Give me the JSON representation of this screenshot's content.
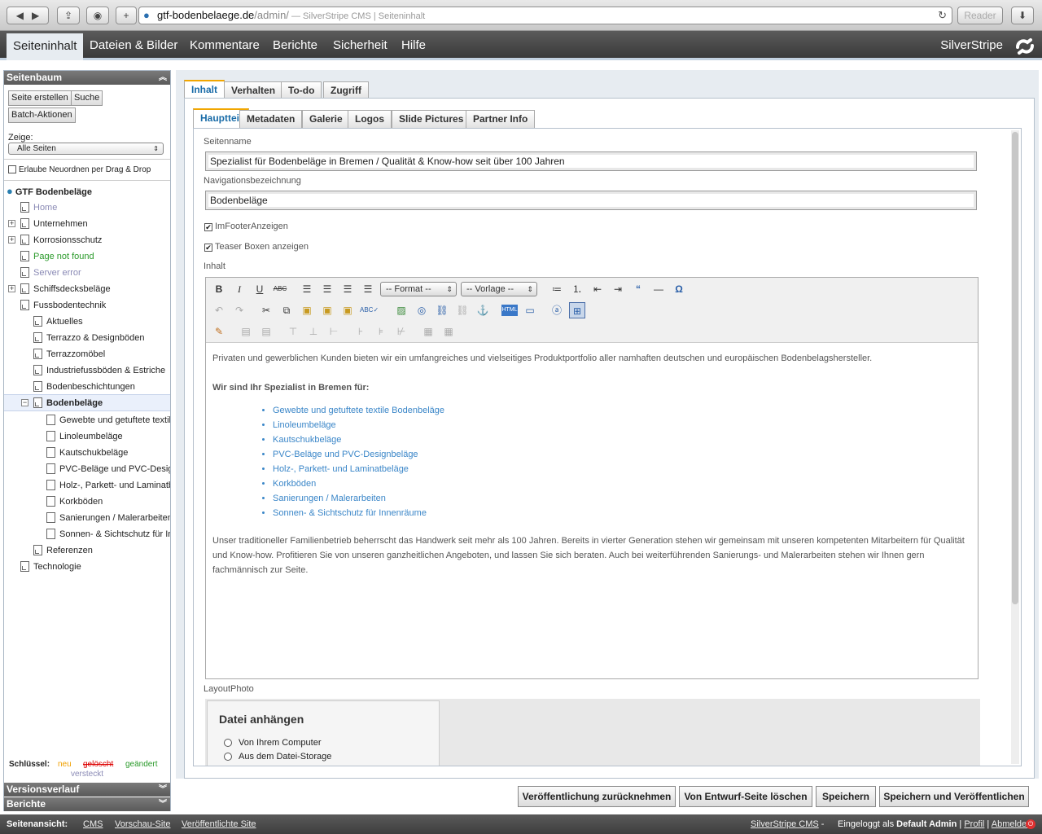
{
  "browser": {
    "reader_label": "Reader",
    "url_domain": "gtf-bodenbelaege.de",
    "url_path": "/admin/",
    "page_title": " — SilverStripe CMS | Seiteninhalt"
  },
  "topmenu": {
    "items": [
      "Seiteninhalt",
      "Dateien & Bilder",
      "Kommentare",
      "Berichte",
      "Sicherheit",
      "Hilfe"
    ],
    "brand": "SilverStripe"
  },
  "sidebar": {
    "tree_title": "Seitenbaum",
    "create_button": "Seite erstellen",
    "search_button": "Suche",
    "batch_button": "Batch-Aktionen",
    "show_label": "Zeige:",
    "show_value": "Alle Seiten",
    "dragdrop_label": "Erlaube Neuordnen per Drag & Drop",
    "root": "GTF Bodenbeläge",
    "tree": [
      {
        "label": "Home",
        "level": 1,
        "color": "#8a8ab5",
        "expander": ""
      },
      {
        "label": "Unternehmen",
        "level": 1,
        "color": "#222",
        "expander": "+"
      },
      {
        "label": "Korrosionsschutz",
        "level": 1,
        "color": "#222",
        "expander": "+"
      },
      {
        "label": "Page not found",
        "level": 1,
        "color": "#2a9a2a",
        "expander": ""
      },
      {
        "label": "Server error",
        "level": 1,
        "color": "#8a8ab5",
        "expander": ""
      },
      {
        "label": "Schiffsdecksbeläge",
        "level": 1,
        "color": "#222",
        "expander": "+"
      },
      {
        "label": "Fussbodentechnik",
        "level": 1,
        "color": "#222",
        "expander": ""
      },
      {
        "label": "Aktuelles",
        "level": 2,
        "color": "#222",
        "expander": ""
      },
      {
        "label": "Terrazzo & Designböden",
        "level": 2,
        "color": "#222",
        "expander": ""
      },
      {
        "label": "Terrazzomöbel",
        "level": 2,
        "color": "#222",
        "expander": ""
      },
      {
        "label": "Industriefussböden & Estriche",
        "level": 2,
        "color": "#222",
        "expander": ""
      },
      {
        "label": "Bodenbeschichtungen",
        "level": 2,
        "color": "#222",
        "expander": ""
      },
      {
        "label": "Bodenbeläge",
        "level": 2,
        "color": "#222",
        "expander": "−",
        "selected": true
      },
      {
        "label": "Gewebte und getuftete textil",
        "level": 3,
        "color": "#222",
        "expander": ""
      },
      {
        "label": "Linoleumbeläge",
        "level": 3,
        "color": "#222",
        "expander": ""
      },
      {
        "label": "Kautschukbeläge",
        "level": 3,
        "color": "#222",
        "expander": ""
      },
      {
        "label": "PVC-Beläge und PVC-Desig",
        "level": 3,
        "color": "#222",
        "expander": ""
      },
      {
        "label": "Holz-, Parkett- und Laminatb",
        "level": 3,
        "color": "#222",
        "expander": ""
      },
      {
        "label": "Korkböden",
        "level": 3,
        "color": "#222",
        "expander": ""
      },
      {
        "label": "Sanierungen / Malerarbeiten",
        "level": 3,
        "color": "#222",
        "expander": ""
      },
      {
        "label": "Sonnen- & Sichtschutz für In",
        "level": 3,
        "color": "#222",
        "expander": ""
      },
      {
        "label": "Referenzen",
        "level": 2,
        "color": "#222",
        "expander": ""
      },
      {
        "label": "Technologie",
        "level": 1,
        "color": "#222",
        "expander": ""
      }
    ],
    "legend_label": "Schlüssel:",
    "legend_new": "neu",
    "legend_deleted": "gelöscht",
    "legend_changed": "geändert",
    "legend_hidden": "versteckt",
    "history_title": "Versionsverlauf",
    "reports_title": "Berichte"
  },
  "tabs": [
    "Inhalt",
    "Verhalten",
    "To-do",
    "Zugriff"
  ],
  "subtabs": [
    "Hauptteil",
    "Metadaten",
    "Galerie",
    "Logos",
    "Slide Pictures",
    "Partner Info"
  ],
  "form": {
    "pagename_label": "Seitenname",
    "pagename_value": "Spezialist für Bodenbeläge in Bremen / Qualität & Know-how seit über 100 Jahren",
    "nav_label": "Navigationsbezeichnung",
    "nav_value": "Bodenbeläge",
    "footer_chk": "ImFooterAnzeigen",
    "teaser_chk": "Teaser Boxen anzeigen",
    "content_label": "Inhalt",
    "format_select": "-- Format --",
    "template_select": "-- Vorlage --",
    "content": {
      "intro": "Privaten und gewerblichen Kunden bieten wir ein umfangreiches und vielseitiges Produktportfolio aller namhaften deutschen und europäischen Bodenbelagshersteller.",
      "heading": "Wir sind Ihr Spezialist in Bremen für:",
      "items": [
        "Gewebte und getuftete textile Bodenbeläge",
        "Linoleumbeläge",
        "Kautschukbeläge",
        "PVC-Beläge und PVC-Designbeläge",
        "Holz-, Parkett- und Laminatbeläge",
        "Korkböden",
        "Sanierungen / Malerarbeiten",
        "Sonnen- & Sichtschutz für Innenräume"
      ],
      "outro": "Unser traditioneller Familienbetrieb beherrscht das Handwerk seit mehr als 100 Jahren. Bereits in vierter Generation stehen wir gemeinsam mit unseren kompetenten Mitarbeitern für Qualität und Know-how. Profitieren Sie von unseren ganzheitlichen Angeboten, und lassen Sie sich beraten. Auch bei weiterführenden Sanierungs- und Malerarbeiten stehen wir Ihnen gern fachmännisch zur Seite."
    },
    "layoutphoto_label": "LayoutPhoto",
    "attach_title": "Datei anhängen",
    "from_computer": "Von Ihrem Computer",
    "from_storage": "Aus dem Datei-Storage"
  },
  "actions": [
    "Veröffentlichung zurücknehmen",
    "Von Entwurf-Seite löschen",
    "Speichern",
    "Speichern und Veröffentlichen"
  ],
  "footer": {
    "label": "Seitenansicht:",
    "cms": "CMS",
    "preview": "Vorschau-Site",
    "published": "Veröffentlichte Site",
    "ss_link": "SilverStripe CMS",
    "ss_dash": " -",
    "logged_prefix": "Eingeloggt als",
    "user": "Default Admin",
    "profile": "Profil",
    "logout": "Abmelden"
  }
}
